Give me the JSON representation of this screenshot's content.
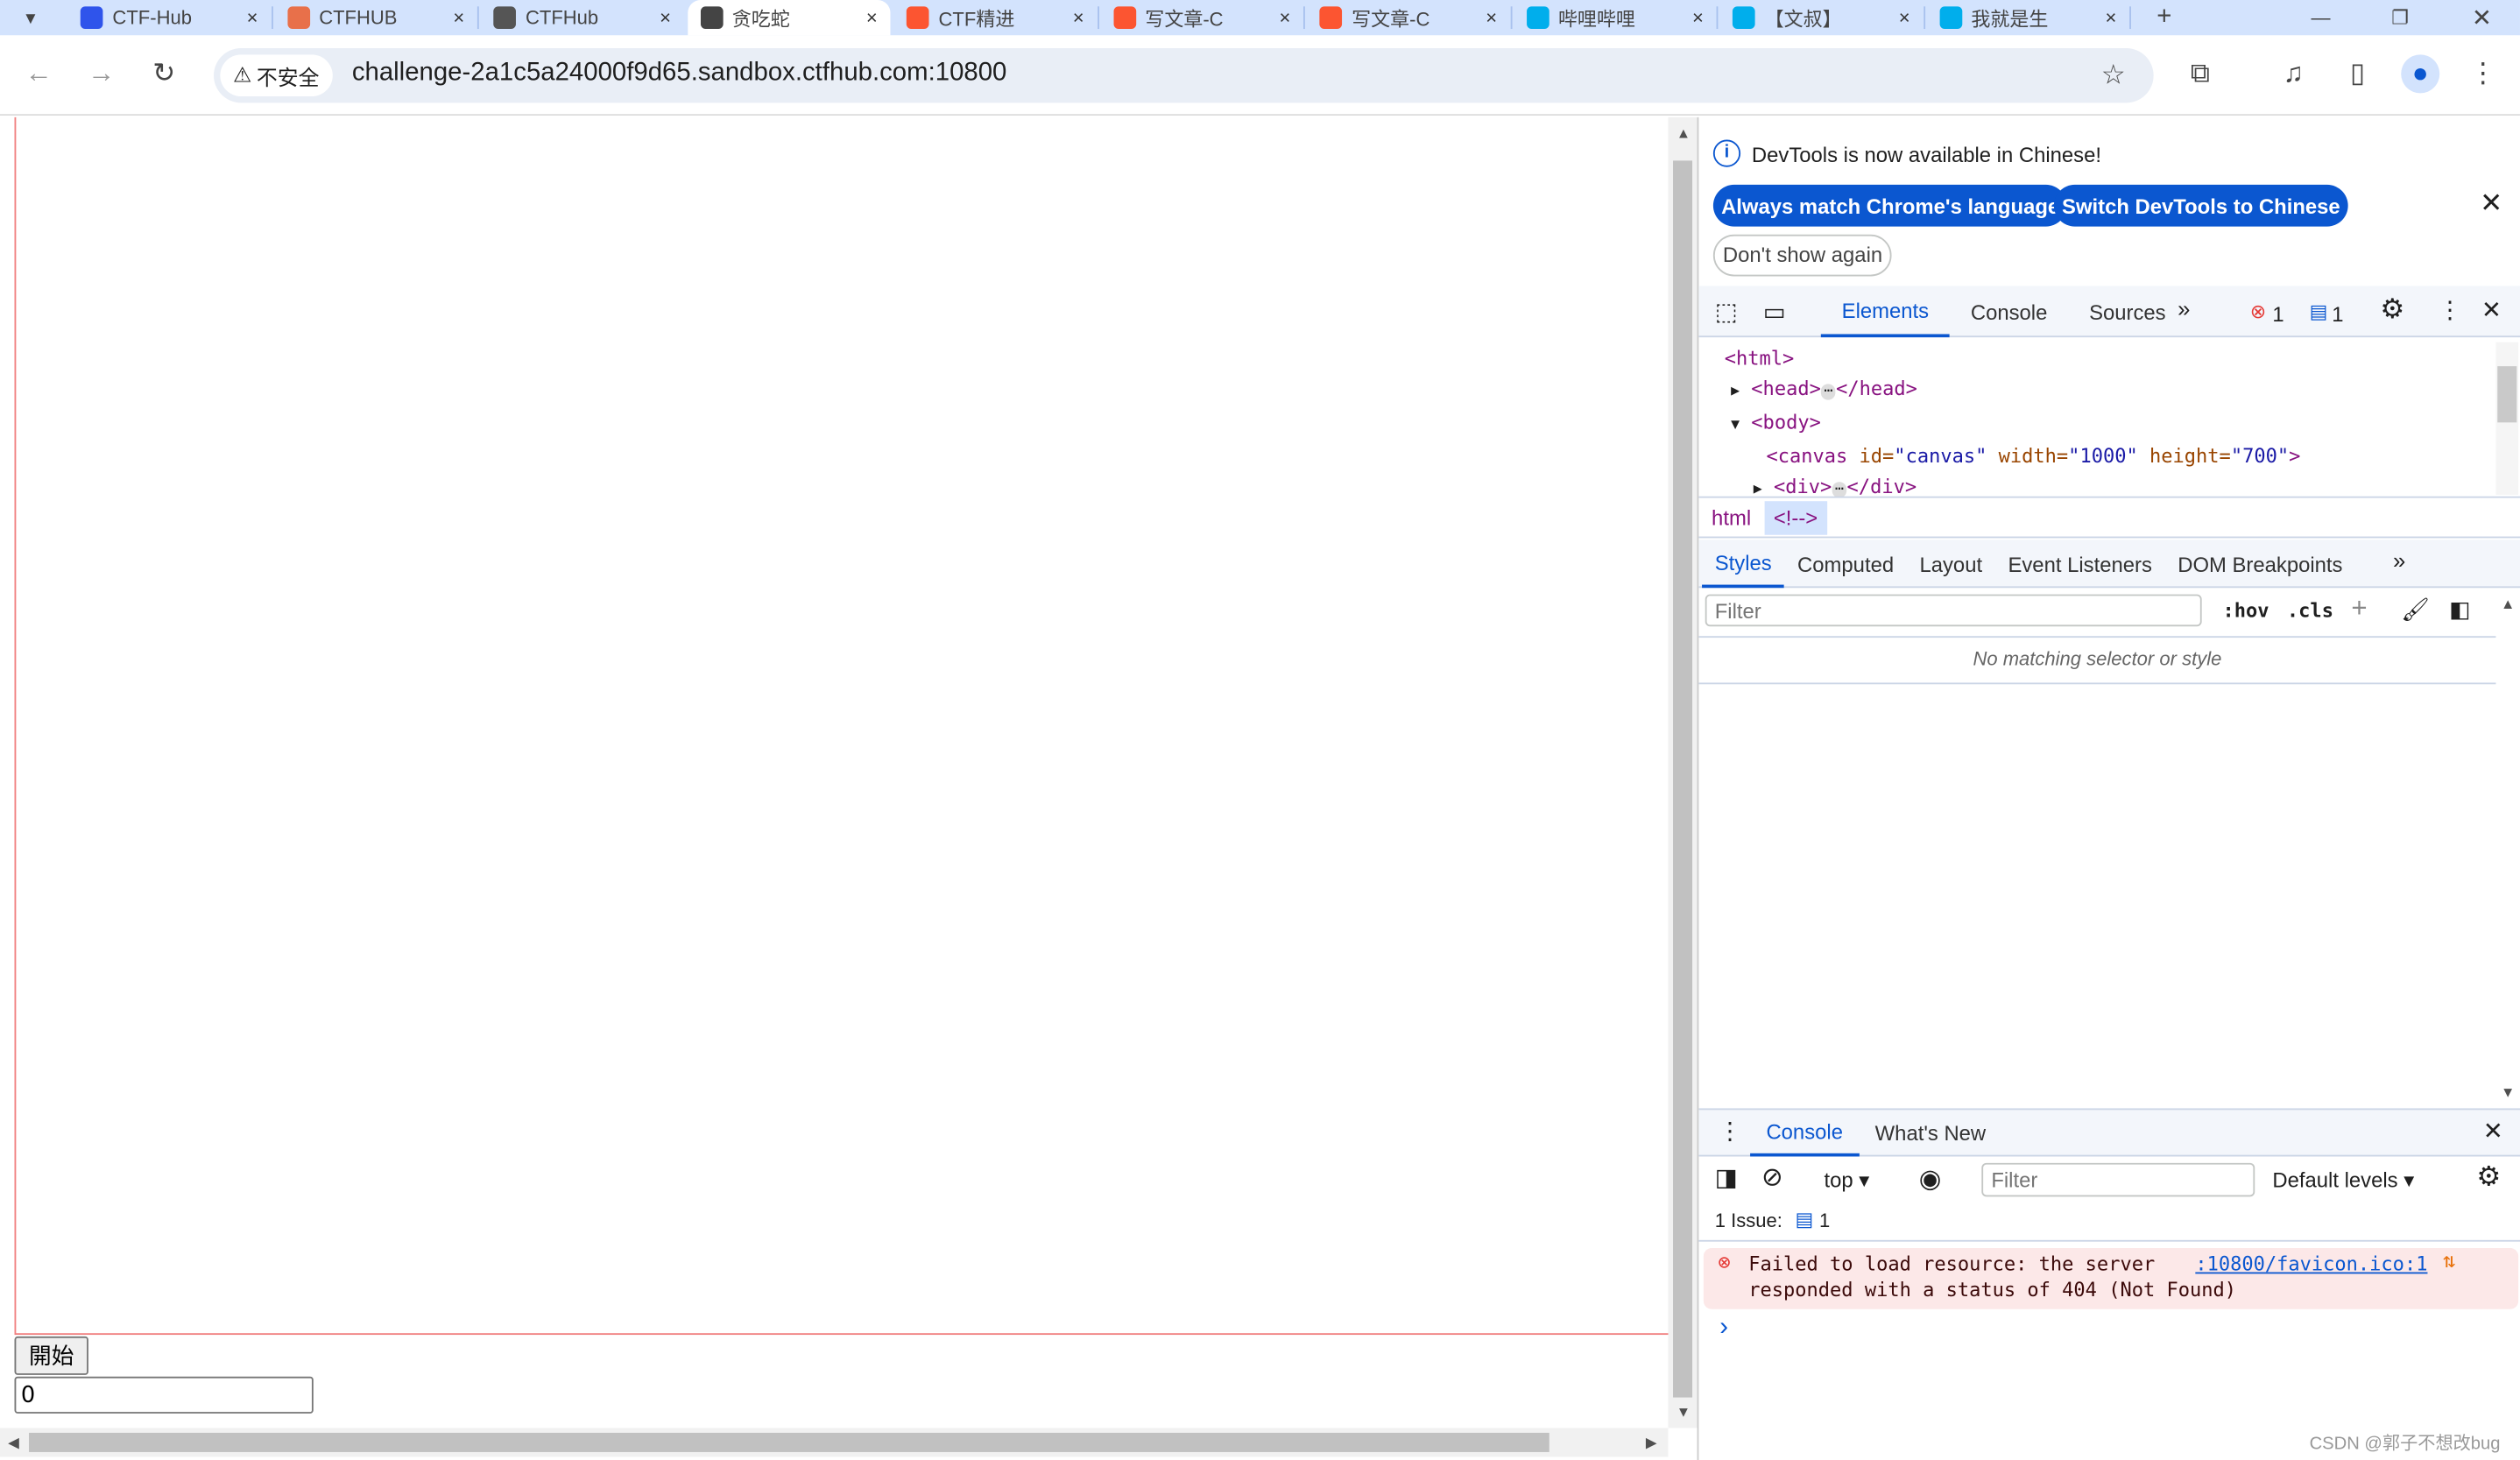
{
  "browser": {
    "tabs": [
      {
        "title": "CTF-Hub",
        "icon_color": "#2f54eb"
      },
      {
        "title": "CTFHUB",
        "icon_color": "#e8704a"
      },
      {
        "title": "CTFHub",
        "icon_color": "#555555"
      },
      {
        "title": "贪吃蛇",
        "icon_color": "#444444",
        "active": true
      },
      {
        "title": "CTF精进",
        "icon_color": "#fc5531"
      },
      {
        "title": "写文章-C",
        "icon_color": "#fc5531"
      },
      {
        "title": "写文章-C",
        "icon_color": "#fc5531"
      },
      {
        "title": "哔哩哔哩",
        "icon_color": "#00aeec"
      },
      {
        "title": "【文叔】",
        "icon_color": "#00aeec"
      },
      {
        "title": "我就是生",
        "icon_color": "#00aeec"
      }
    ],
    "close_glyph": "×",
    "new_tab": "+",
    "security_label": "不安全",
    "url": "challenge-2a1c5a24000f9d65.sandbox.ctfhub.com:10800"
  },
  "page": {
    "start_button": "開始",
    "score_value": "0"
  },
  "devtools": {
    "banner_text": "DevTools is now available in Chinese!",
    "btn_match": "Always match Chrome's language",
    "btn_switch": "Switch DevTools to Chinese",
    "btn_dont_show": "Don't show again",
    "tabs": [
      "Elements",
      "Console",
      "Sources"
    ],
    "error_count": "1",
    "issue_count": "1",
    "dom": {
      "html": "<html>",
      "head_open": "<head>",
      "head_close": "</head>",
      "body": "<body>",
      "canvas_tag": "<canvas",
      "canvas_id_attr": "id=",
      "canvas_id": "\"canvas\"",
      "canvas_w_attr": "width=",
      "canvas_w": "\"1000\"",
      "canvas_h_attr": "height=",
      "canvas_h": "\"700\"",
      "canvas_end": ">",
      "div_open": "<div>",
      "div_close": "</div>"
    },
    "breadcrumbs": [
      "html",
      "<!-->"
    ],
    "styles_tabs": [
      "Styles",
      "Computed",
      "Layout",
      "Event Listeners",
      "DOM Breakpoints"
    ],
    "filter_placeholder": "Filter",
    "hov": ":hov",
    "cls": ".cls",
    "no_match": "No matching selector or style",
    "drawer_tabs": [
      "Console",
      "What's New"
    ],
    "context": "top",
    "console_filter_placeholder": "Filter",
    "levels": "Default levels",
    "issues_label": "1 Issue:",
    "issues_count": "1",
    "error_message_1": "Failed to load resource: the server",
    "error_message_2": "responded with a status of 404 (Not Found)",
    "error_source": ":10800/favicon.ico:1",
    "prompt": "›"
  },
  "watermark": "CSDN @郭子不想改bug",
  "colors": {
    "accent": "#0b57d0",
    "error": "#e53935",
    "canvas_border": "#f08080"
  }
}
